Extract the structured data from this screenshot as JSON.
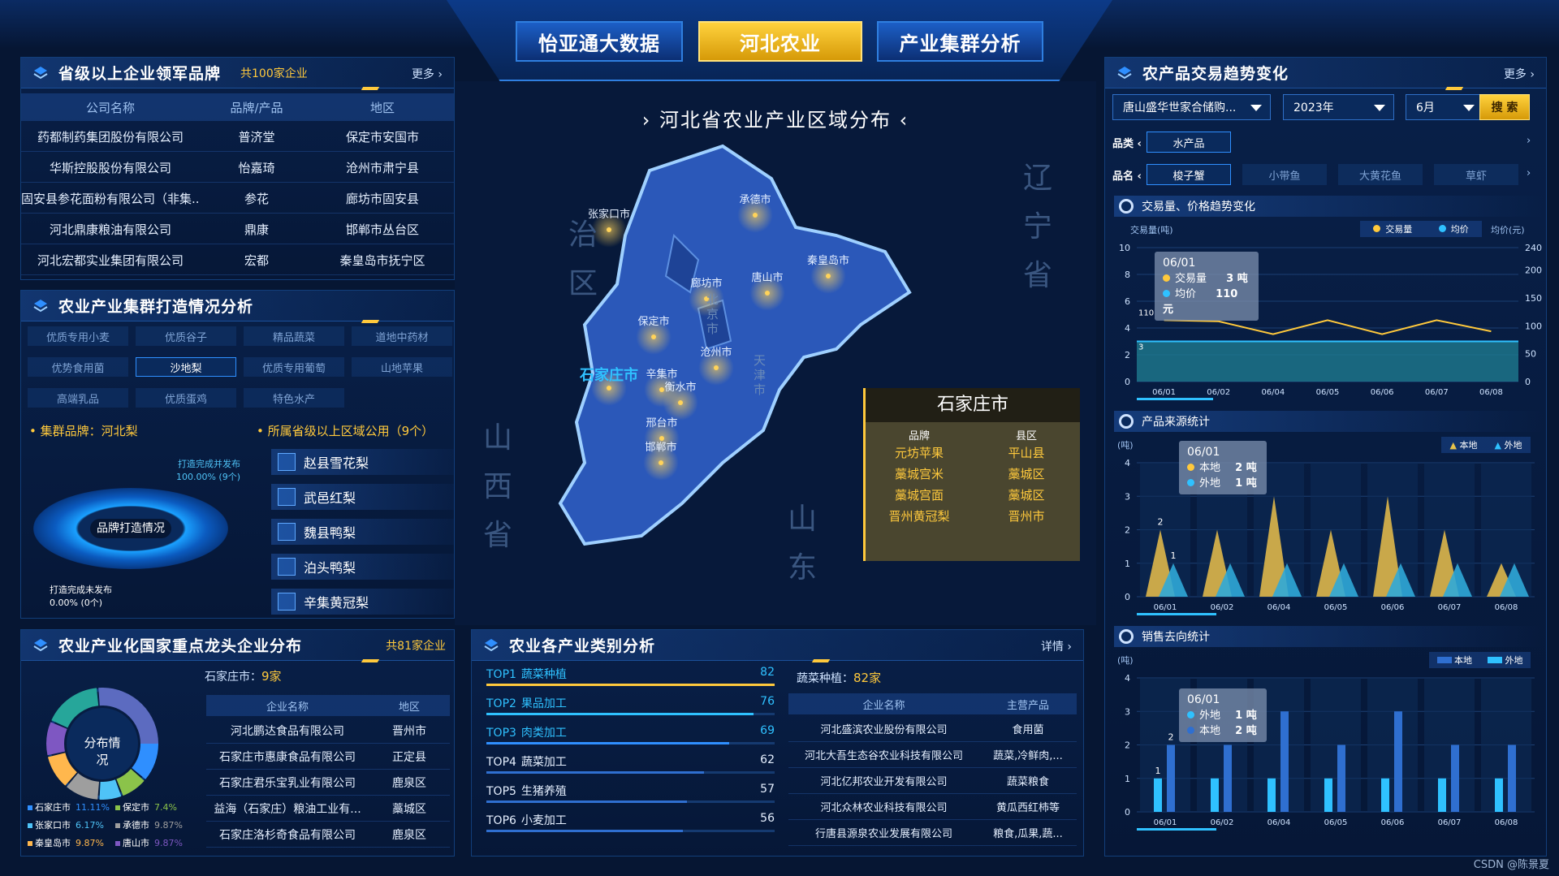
{
  "nav": {
    "left": "怡亚通大数据",
    "center": "河北农业",
    "right": "产业集群分析"
  },
  "brands": {
    "title": "省级以上企业领军品牌",
    "count": "共100家企业",
    "more": "更多",
    "headers": [
      "公司名称",
      "品牌/产品",
      "地区"
    ],
    "rows": [
      [
        "药都制药集团股份有限公司",
        "普济堂",
        "保定市安国市"
      ],
      [
        "华斯控股股份有限公司",
        "怡嘉琦",
        "沧州市肃宁县"
      ],
      [
        "固安县参花面粉有限公司（非集...",
        "参花",
        "廊坊市固安县"
      ],
      [
        "河北鼎康粮油有限公司",
        "鼎康",
        "邯郸市丛台区"
      ],
      [
        "河北宏都实业集团有限公司",
        "宏都",
        "秦皇岛市抚宁区"
      ]
    ]
  },
  "cluster": {
    "title": "农业产业集群打造情况分析",
    "chips": [
      [
        "优质专用小麦",
        "优质谷子",
        "精品蔬菜",
        "道地中药材"
      ],
      [
        "优势食用菌",
        "沙地梨",
        "优质专用葡萄",
        "山地苹果"
      ],
      [
        "高端乳品",
        "优质蛋鸡",
        "特色水产"
      ]
    ],
    "brand_label": "集群品牌：河北梨",
    "region_label": "所属省级以上区域公用（9个）",
    "done_text": "打造完成并发布",
    "done_pct": "100.00% (9个)",
    "ring_label": "品牌打造情况",
    "undone_text": "打造完成未发布",
    "undone_pct": "0.00% (0个)",
    "pears": [
      "赵县雪花梨",
      "武邑红梨",
      "魏县鸭梨",
      "泊头鸭梨",
      "辛集黄冠梨"
    ]
  },
  "dragon": {
    "title": "农业产业化国家重点龙头企业分布",
    "count": "共81家企业",
    "donut_label": "分布情况",
    "city_label": "石家庄市：",
    "city_count": "9家",
    "headers": [
      "企业名称",
      "地区"
    ],
    "rows": [
      [
        "河北鹏达食品有限公司",
        "晋州市"
      ],
      [
        "石家庄市惠康食品有限公司",
        "正定县"
      ],
      [
        "石家庄君乐宝乳业有限公司",
        "鹿泉区"
      ],
      [
        "益海（石家庄）粮油工业有...",
        "藁城区"
      ],
      [
        "石家庄洛杉奇食品有限公司",
        "鹿泉区"
      ]
    ],
    "legend": [
      {
        "name": "石家庄市",
        "pct": "11.11%",
        "color": "#2f8fff"
      },
      {
        "name": "保定市",
        "pct": "7.4%",
        "color": "#8bc34a"
      },
      {
        "name": "张家口市",
        "pct": "6.17%",
        "color": "#4fc3f7"
      },
      {
        "name": "承德市",
        "pct": "9.87%",
        "color": "#9e9e9e"
      },
      {
        "name": "秦皇岛市",
        "pct": "9.87%",
        "color": "#ffb74d"
      },
      {
        "name": "唐山市",
        "pct": "9.87%",
        "color": "#7e57c2"
      }
    ]
  },
  "industry": {
    "title": "农业各产业类别分析",
    "more": "详情",
    "items": [
      {
        "rank": "TOP1",
        "name": "蔬菜种植",
        "value": 82,
        "color": "#ffc93c"
      },
      {
        "rank": "TOP2",
        "name": "果品加工",
        "value": 76,
        "color": "#2fc1ff"
      },
      {
        "rank": "TOP3",
        "name": "肉类加工",
        "value": 69,
        "color": "#2f8fff"
      },
      {
        "rank": "TOP4",
        "name": "蔬菜加工",
        "value": 62,
        "color": "#2f6fd0"
      },
      {
        "rank": "TOP5",
        "name": "生猪养殖",
        "value": 57,
        "color": "#2f6fd0"
      },
      {
        "rank": "TOP6",
        "name": "小麦加工",
        "value": 56,
        "color": "#2f6fd0"
      }
    ],
    "sel_label": "蔬菜种植：",
    "sel_count": "82家",
    "headers": [
      "企业名称",
      "主营产品"
    ],
    "rows": [
      [
        "河北盛滨农业股份有限公司",
        "食用菌"
      ],
      [
        "河北大吾生态谷农业科技有限公司",
        "蔬菜,冷鲜肉,..."
      ],
      [
        "河北亿邦农业开发有限公司",
        "蔬菜粮食"
      ],
      [
        "河北众林农业科技有限公司",
        "黄瓜西红柿等"
      ],
      [
        "行唐县源泉农业发展有限公司",
        "粮食,瓜果,蔬..."
      ]
    ]
  },
  "map": {
    "title": "河北省农业产业区域分布",
    "cities": [
      "张家口市",
      "承德市",
      "秦皇岛市",
      "唐山市",
      "廊坊市",
      "保定市",
      "沧州市",
      "石家庄市",
      "辛集市",
      "衡水市",
      "邢台市",
      "邯郸市"
    ],
    "neighbors": [
      "治",
      "区",
      "辽",
      "宁",
      "省",
      "山",
      "西",
      "省",
      "山",
      "东",
      "北",
      "京",
      "市",
      "天",
      "津",
      "市"
    ],
    "popup": {
      "city": "石家庄市",
      "headers": [
        "品牌",
        "县区"
      ],
      "rows": [
        [
          "元坊苹果",
          "平山县"
        ],
        [
          "藁城宫米",
          "藁城区"
        ],
        [
          "藁城宫面",
          "藁城区"
        ],
        [
          "晋州黄冠梨",
          "晋州市"
        ]
      ]
    }
  },
  "trade": {
    "title": "农产品交易趋势变化",
    "more": "更多",
    "select1": "唐山盛华世家合储购...",
    "select2": "2023年",
    "select3": "6月",
    "search": "搜 索",
    "cat_label": "品类",
    "cat_value": "水产品",
    "name_label": "品名",
    "names": [
      "梭子蟹",
      "小带鱼",
      "大黄花鱼",
      "草虾"
    ],
    "chart_title": "交易量、价格趋势变化",
    "left_axis": "交易量(吨)",
    "right_axis": "均价(元)",
    "legend_volume": "交易量",
    "legend_price": "均价",
    "tip": {
      "date": "06/01",
      "v_label": "交易量",
      "v_value": "3 吨",
      "p_label": "均价",
      "p_value": "110 元"
    },
    "source_title": "产品来源统计",
    "source_unit": "(吨)",
    "source_tip": {
      "date": "06/01",
      "a": "本地",
      "a_v": "2 吨",
      "b": "外地",
      "b_v": "1 吨"
    },
    "sales_title": "销售去向统计",
    "sales_unit": "(吨)",
    "sales_tip": {
      "date": "06/01",
      "a": "外地",
      "a_v": "1 吨",
      "b": "本地",
      "b_v": "2 吨"
    },
    "local": "本地",
    "remote": "外地"
  },
  "chart_data": [
    {
      "type": "line",
      "title": "交易量、价格趋势变化",
      "x": [
        "06/01",
        "06/02",
        "06/04",
        "06/05",
        "06/06",
        "06/07",
        "06/08"
      ],
      "series": [
        {
          "name": "交易量",
          "values": [
            3,
            3,
            3,
            3,
            3,
            3,
            3
          ]
        },
        {
          "name": "均价",
          "values": [
            110,
            108,
            85,
            110,
            85,
            110,
            90
          ]
        }
      ],
      "ylim": [
        0,
        10
      ],
      "y2lim": [
        0,
        240
      ]
    },
    {
      "type": "bar",
      "title": "产品来源统计",
      "categories": [
        "06/01",
        "06/02",
        "06/04",
        "06/05",
        "06/06",
        "06/07",
        "06/08"
      ],
      "series": [
        {
          "name": "本地",
          "values": [
            2,
            2,
            3,
            2,
            3,
            2,
            1
          ]
        },
        {
          "name": "外地",
          "values": [
            1,
            1,
            1,
            1,
            1,
            1,
            1
          ]
        }
      ],
      "ylim": [
        0,
        4
      ]
    },
    {
      "type": "bar",
      "title": "销售去向统计",
      "categories": [
        "06/01",
        "06/02",
        "06/04",
        "06/05",
        "06/06",
        "06/07",
        "06/08"
      ],
      "series": [
        {
          "name": "本地",
          "values": [
            2,
            2,
            3,
            2,
            3,
            2,
            2
          ]
        },
        {
          "name": "外地",
          "values": [
            1,
            1,
            1,
            1,
            1,
            1,
            1
          ]
        }
      ],
      "ylim": [
        0,
        4
      ]
    }
  ],
  "footer": "CSDN @陈景夏"
}
